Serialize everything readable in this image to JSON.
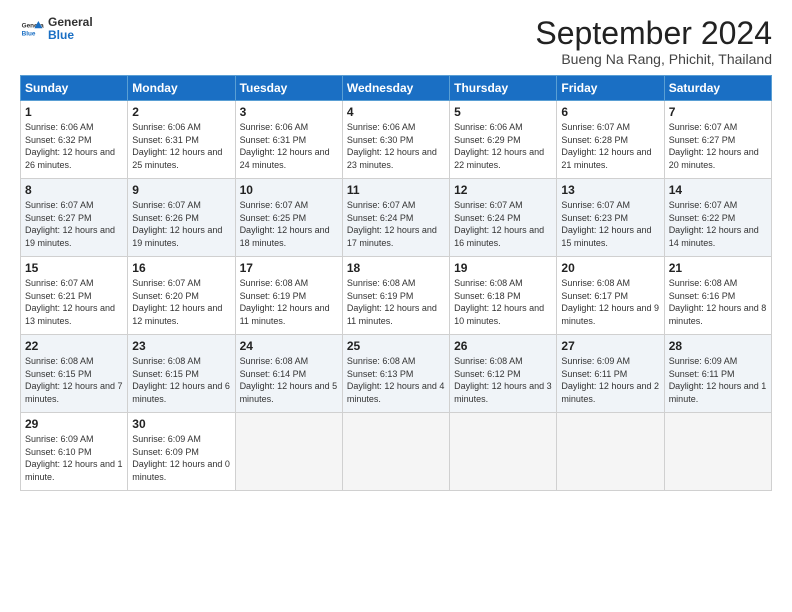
{
  "header": {
    "logo_general": "General",
    "logo_blue": "Blue",
    "month_title": "September 2024",
    "location": "Bueng Na Rang, Phichit, Thailand"
  },
  "days_of_week": [
    "Sunday",
    "Monday",
    "Tuesday",
    "Wednesday",
    "Thursday",
    "Friday",
    "Saturday"
  ],
  "weeks": [
    [
      {
        "day": "1",
        "sunrise": "Sunrise: 6:06 AM",
        "sunset": "Sunset: 6:32 PM",
        "daylight": "Daylight: 12 hours and 26 minutes."
      },
      {
        "day": "2",
        "sunrise": "Sunrise: 6:06 AM",
        "sunset": "Sunset: 6:31 PM",
        "daylight": "Daylight: 12 hours and 25 minutes."
      },
      {
        "day": "3",
        "sunrise": "Sunrise: 6:06 AM",
        "sunset": "Sunset: 6:31 PM",
        "daylight": "Daylight: 12 hours and 24 minutes."
      },
      {
        "day": "4",
        "sunrise": "Sunrise: 6:06 AM",
        "sunset": "Sunset: 6:30 PM",
        "daylight": "Daylight: 12 hours and 23 minutes."
      },
      {
        "day": "5",
        "sunrise": "Sunrise: 6:06 AM",
        "sunset": "Sunset: 6:29 PM",
        "daylight": "Daylight: 12 hours and 22 minutes."
      },
      {
        "day": "6",
        "sunrise": "Sunrise: 6:07 AM",
        "sunset": "Sunset: 6:28 PM",
        "daylight": "Daylight: 12 hours and 21 minutes."
      },
      {
        "day": "7",
        "sunrise": "Sunrise: 6:07 AM",
        "sunset": "Sunset: 6:27 PM",
        "daylight": "Daylight: 12 hours and 20 minutes."
      }
    ],
    [
      {
        "day": "8",
        "sunrise": "Sunrise: 6:07 AM",
        "sunset": "Sunset: 6:27 PM",
        "daylight": "Daylight: 12 hours and 19 minutes."
      },
      {
        "day": "9",
        "sunrise": "Sunrise: 6:07 AM",
        "sunset": "Sunset: 6:26 PM",
        "daylight": "Daylight: 12 hours and 19 minutes."
      },
      {
        "day": "10",
        "sunrise": "Sunrise: 6:07 AM",
        "sunset": "Sunset: 6:25 PM",
        "daylight": "Daylight: 12 hours and 18 minutes."
      },
      {
        "day": "11",
        "sunrise": "Sunrise: 6:07 AM",
        "sunset": "Sunset: 6:24 PM",
        "daylight": "Daylight: 12 hours and 17 minutes."
      },
      {
        "day": "12",
        "sunrise": "Sunrise: 6:07 AM",
        "sunset": "Sunset: 6:24 PM",
        "daylight": "Daylight: 12 hours and 16 minutes."
      },
      {
        "day": "13",
        "sunrise": "Sunrise: 6:07 AM",
        "sunset": "Sunset: 6:23 PM",
        "daylight": "Daylight: 12 hours and 15 minutes."
      },
      {
        "day": "14",
        "sunrise": "Sunrise: 6:07 AM",
        "sunset": "Sunset: 6:22 PM",
        "daylight": "Daylight: 12 hours and 14 minutes."
      }
    ],
    [
      {
        "day": "15",
        "sunrise": "Sunrise: 6:07 AM",
        "sunset": "Sunset: 6:21 PM",
        "daylight": "Daylight: 12 hours and 13 minutes."
      },
      {
        "day": "16",
        "sunrise": "Sunrise: 6:07 AM",
        "sunset": "Sunset: 6:20 PM",
        "daylight": "Daylight: 12 hours and 12 minutes."
      },
      {
        "day": "17",
        "sunrise": "Sunrise: 6:08 AM",
        "sunset": "Sunset: 6:19 PM",
        "daylight": "Daylight: 12 hours and 11 minutes."
      },
      {
        "day": "18",
        "sunrise": "Sunrise: 6:08 AM",
        "sunset": "Sunset: 6:19 PM",
        "daylight": "Daylight: 12 hours and 11 minutes."
      },
      {
        "day": "19",
        "sunrise": "Sunrise: 6:08 AM",
        "sunset": "Sunset: 6:18 PM",
        "daylight": "Daylight: 12 hours and 10 minutes."
      },
      {
        "day": "20",
        "sunrise": "Sunrise: 6:08 AM",
        "sunset": "Sunset: 6:17 PM",
        "daylight": "Daylight: 12 hours and 9 minutes."
      },
      {
        "day": "21",
        "sunrise": "Sunrise: 6:08 AM",
        "sunset": "Sunset: 6:16 PM",
        "daylight": "Daylight: 12 hours and 8 minutes."
      }
    ],
    [
      {
        "day": "22",
        "sunrise": "Sunrise: 6:08 AM",
        "sunset": "Sunset: 6:15 PM",
        "daylight": "Daylight: 12 hours and 7 minutes."
      },
      {
        "day": "23",
        "sunrise": "Sunrise: 6:08 AM",
        "sunset": "Sunset: 6:15 PM",
        "daylight": "Daylight: 12 hours and 6 minutes."
      },
      {
        "day": "24",
        "sunrise": "Sunrise: 6:08 AM",
        "sunset": "Sunset: 6:14 PM",
        "daylight": "Daylight: 12 hours and 5 minutes."
      },
      {
        "day": "25",
        "sunrise": "Sunrise: 6:08 AM",
        "sunset": "Sunset: 6:13 PM",
        "daylight": "Daylight: 12 hours and 4 minutes."
      },
      {
        "day": "26",
        "sunrise": "Sunrise: 6:08 AM",
        "sunset": "Sunset: 6:12 PM",
        "daylight": "Daylight: 12 hours and 3 minutes."
      },
      {
        "day": "27",
        "sunrise": "Sunrise: 6:09 AM",
        "sunset": "Sunset: 6:11 PM",
        "daylight": "Daylight: 12 hours and 2 minutes."
      },
      {
        "day": "28",
        "sunrise": "Sunrise: 6:09 AM",
        "sunset": "Sunset: 6:11 PM",
        "daylight": "Daylight: 12 hours and 1 minute."
      }
    ],
    [
      {
        "day": "29",
        "sunrise": "Sunrise: 6:09 AM",
        "sunset": "Sunset: 6:10 PM",
        "daylight": "Daylight: 12 hours and 1 minute."
      },
      {
        "day": "30",
        "sunrise": "Sunrise: 6:09 AM",
        "sunset": "Sunset: 6:09 PM",
        "daylight": "Daylight: 12 hours and 0 minutes."
      },
      null,
      null,
      null,
      null,
      null
    ]
  ]
}
